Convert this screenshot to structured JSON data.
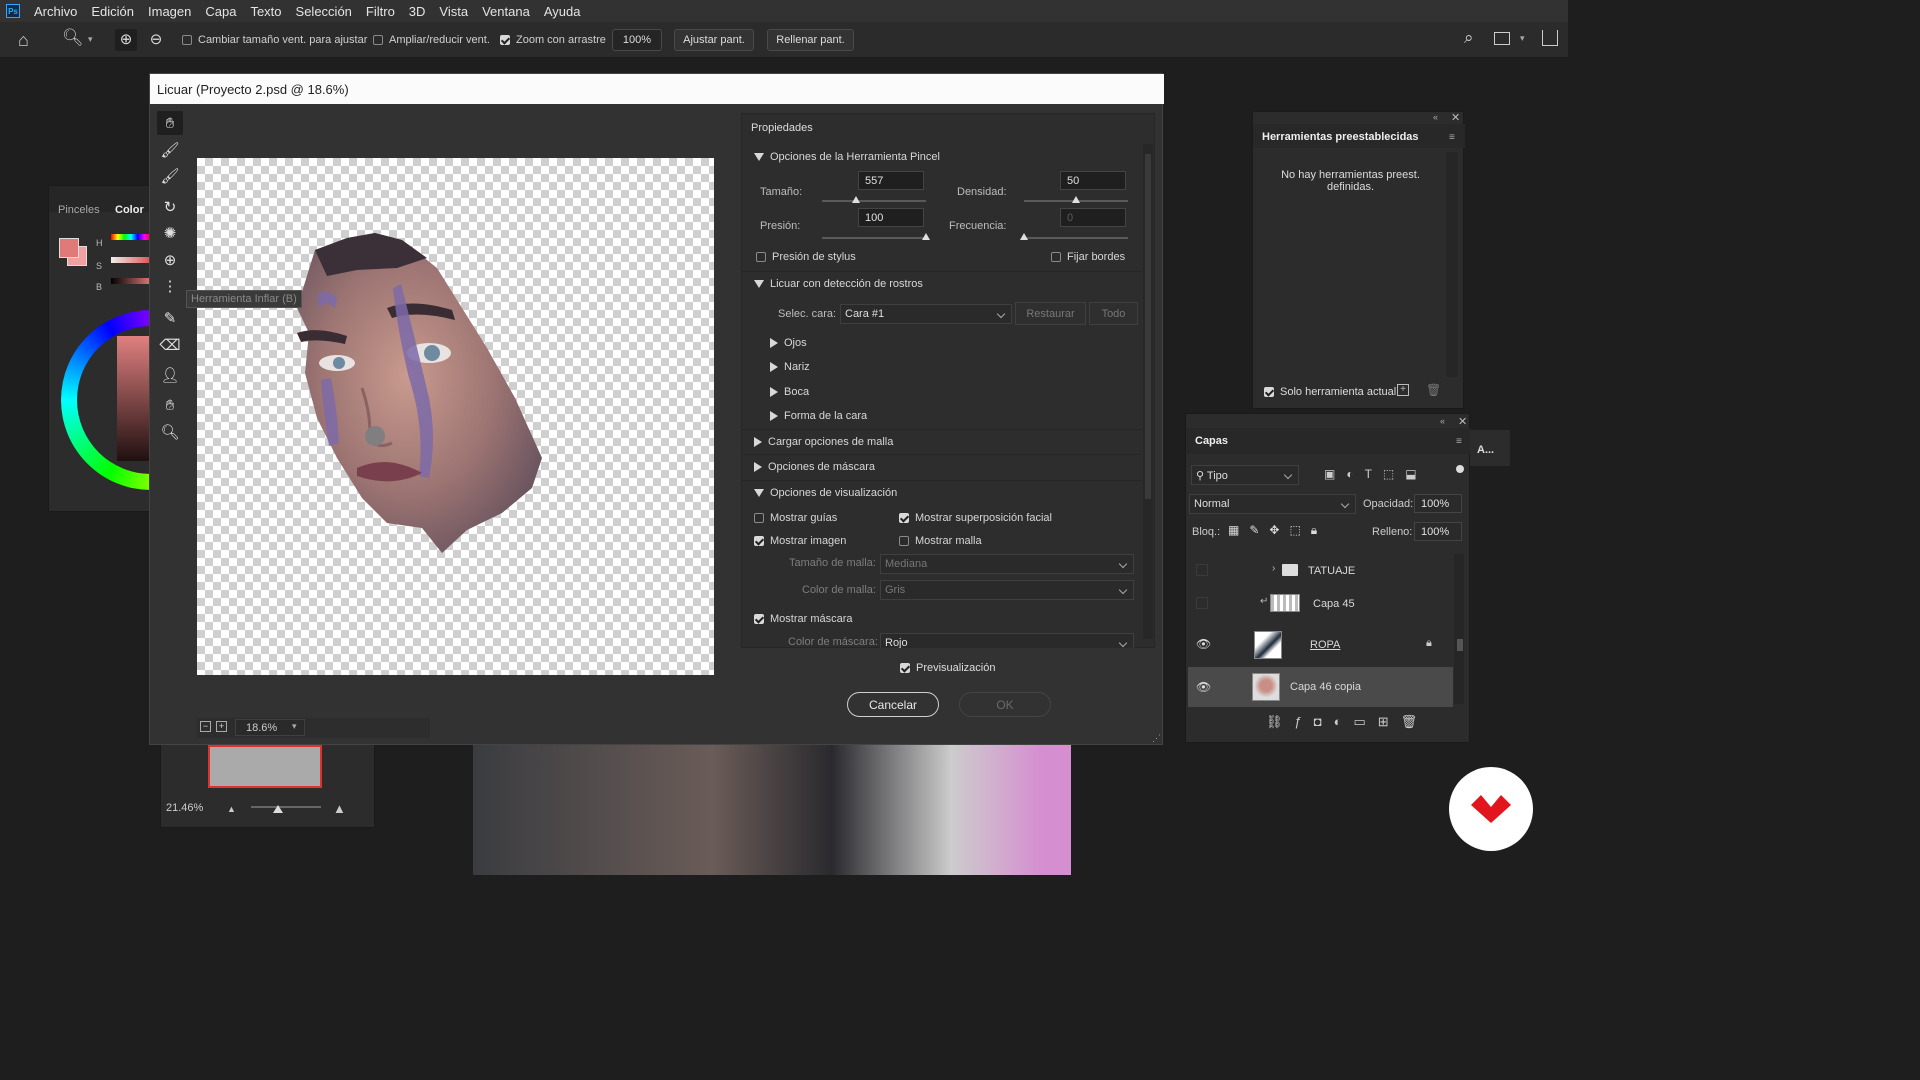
{
  "menubar": {
    "app_icon": "Ps",
    "items": [
      "Archivo",
      "Edición",
      "Imagen",
      "Capa",
      "Texto",
      "Selección",
      "Filtro",
      "3D",
      "Vista",
      "Ventana",
      "Ayuda"
    ]
  },
  "optionsbar": {
    "cb_resize": "Cambiar tamaño vent. para ajustar",
    "cb_zoom_all": "Ampliar/reducir vent.",
    "cb_scrubby": "Zoom con arrastre",
    "zoom_value": "100%",
    "fit_screen": "Ajustar pant.",
    "fill_screen": "Rellenar pant."
  },
  "left_panel": {
    "tab_brushes": "Pinceles",
    "tab_color": "Color",
    "h": "H",
    "s": "S",
    "b": "B"
  },
  "navigator": {
    "zoom": "21.46%"
  },
  "dialog": {
    "title": "Licuar (Proyecto 2.psd @ 18.6%)",
    "tooltip": "Herramienta Inflar (B)",
    "zoom": "18.6%",
    "properties_title": "Propiedades",
    "brush_options": "Opciones de la Herramienta Pincel",
    "size_label": "Tamaño:",
    "size_value": "557",
    "size_level": 0.33,
    "density_label": "Densidad:",
    "density_value": "50",
    "density_level": 0.5,
    "pressure_label": "Presión:",
    "pressure_value": "100",
    "pressure_level": 1.0,
    "rate_label": "Frecuencia:",
    "rate_value": "0",
    "rate_level": 0.0,
    "stylus_pressure": "Presión de stylus",
    "pin_edges": "Fijar bordes",
    "face_aware": "Licuar con detección de rostros",
    "select_face_label": "Selec. cara:",
    "select_face_value": "Cara #1",
    "reset": "Restaurar",
    "all": "Todo",
    "eyes": "Ojos",
    "nose": "Nariz",
    "mouth": "Boca",
    "face_shape": "Forma de la cara",
    "load_mesh": "Cargar opciones de malla",
    "mask_options": "Opciones de máscara",
    "view_options": "Opciones de visualización",
    "show_guides": "Mostrar guías",
    "show_face_overlay": "Mostrar superposición facial",
    "show_image": "Mostrar imagen",
    "show_mesh": "Mostrar malla",
    "mesh_size_label": "Tamaño de malla:",
    "mesh_size_value": "Mediana",
    "mesh_color_label": "Color de malla:",
    "mesh_color_value": "Gris",
    "show_mask": "Mostrar máscara",
    "mask_color_label": "Color de máscara:",
    "mask_color_value": "Rojo",
    "preview": "Previsualización",
    "cancel": "Cancelar",
    "ok": "OK"
  },
  "presets_panel": {
    "title": "Herramientas preestablecidas",
    "empty_text": "No hay herramientas preest. definidas.",
    "current_only": "Solo herramienta actual"
  },
  "layers_panel": {
    "title": "Capas",
    "side_tab": "A...",
    "filter": "Tipo",
    "blend_mode": "Normal",
    "opacity_label": "Opacidad:",
    "opacity_value": "100%",
    "lock_label": "Bloq.:",
    "fill_label": "Relleno:",
    "fill_value": "100%",
    "layers": [
      {
        "name": "TATUAJE",
        "visible": false
      },
      {
        "name": "Capa 45",
        "visible": false
      },
      {
        "name": "ROPA",
        "visible": true
      },
      {
        "name": "Capa 46 copia",
        "visible": true
      }
    ]
  },
  "colors": {
    "accent": "#1473e6",
    "brand_badge": "#e2141e"
  }
}
